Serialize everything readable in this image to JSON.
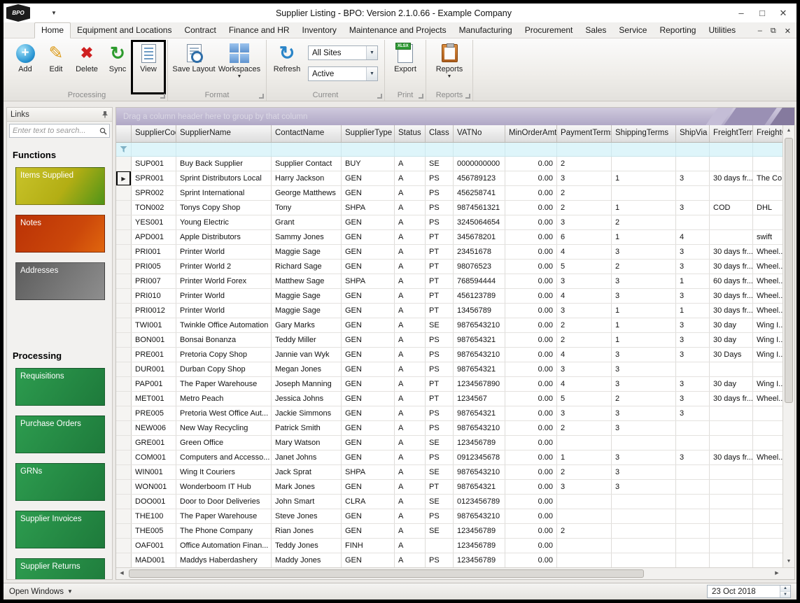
{
  "window": {
    "title": "Supplier Listing - BPO: Version 2.1.0.66 - Example Company",
    "logo_text": "BPO"
  },
  "ribbon": {
    "tabs": [
      "Home",
      "Equipment and Locations",
      "Contract",
      "Finance and HR",
      "Inventory",
      "Maintenance and Projects",
      "Manufacturing",
      "Procurement",
      "Sales",
      "Service",
      "Reporting",
      "Utilities"
    ],
    "active_tab": "Home",
    "buttons": {
      "add": "Add",
      "edit": "Edit",
      "delete": "Delete",
      "sync": "Sync",
      "view": "View",
      "save_layout": "Save Layout",
      "workspaces": "Workspaces",
      "refresh": "Refresh",
      "export": "Export",
      "reports": "Reports"
    },
    "export_badge": "XLSX",
    "dropdowns": {
      "sites": "All Sites",
      "status": "Active"
    },
    "groups": [
      "Processing",
      "Format",
      "Current",
      "Print",
      "Reports"
    ]
  },
  "sidebar": {
    "header": "Links",
    "search_placeholder": "Enter text to search...",
    "sections": [
      {
        "heading": "Functions",
        "items": [
          "Items Supplied",
          "Notes",
          "Addresses"
        ]
      },
      {
        "heading": "Processing",
        "items": [
          "Requisitions",
          "Purchase Orders",
          "GRNs",
          "Supplier Invoices",
          "Supplier Returns"
        ]
      }
    ]
  },
  "grid": {
    "group_hint": "Drag a column header here to group by that column",
    "columns": [
      "SupplierCode",
      "SupplierName",
      "ContactName",
      "SupplierType",
      "Status",
      "Class",
      "VATNo",
      "MinOrderAmt",
      "PaymentTerms",
      "ShippingTerms",
      "ShipVia",
      "FreightTerms",
      "FreightCa..."
    ],
    "focus_row": 1,
    "rows": [
      [
        "SUP001",
        "Buy Back Supplier",
        "Supplier Contact",
        "BUY",
        "A",
        "SE",
        "0000000000",
        "0.00",
        "2",
        "",
        "",
        "",
        ""
      ],
      [
        "SPR001",
        "Sprint Distributors Local",
        "Harry Jackson",
        "GEN",
        "A",
        "PS",
        "456789123",
        "0.00",
        "3",
        "1",
        "3",
        "30 days fr...",
        "The Co..."
      ],
      [
        "SPR002",
        "Sprint International",
        "George Matthews",
        "GEN",
        "A",
        "PS",
        "456258741",
        "0.00",
        "2",
        "",
        "",
        "",
        ""
      ],
      [
        "TON002",
        "Tonys Copy Shop",
        "Tony",
        "SHPA",
        "A",
        "PS",
        "9874561321",
        "0.00",
        "2",
        "1",
        "3",
        "COD",
        "DHL"
      ],
      [
        "YES001",
        "Young Electric",
        "Grant",
        "GEN",
        "A",
        "PS",
        "3245064654",
        "0.00",
        "3",
        "2",
        "",
        "",
        ""
      ],
      [
        "APD001",
        "Apple Distributors",
        "Sammy Jones",
        "GEN",
        "A",
        "PT",
        "345678201",
        "0.00",
        "6",
        "1",
        "4",
        "",
        "swift"
      ],
      [
        "PRI001",
        "Printer World",
        "Maggie Sage",
        "GEN",
        "A",
        "PT",
        "23451678",
        "0.00",
        "4",
        "3",
        "3",
        "30 days fr...",
        "Wheel..."
      ],
      [
        "PRI005",
        "Printer World 2",
        "Richard Sage",
        "GEN",
        "A",
        "PT",
        "98076523",
        "0.00",
        "5",
        "2",
        "3",
        "30 days fr...",
        "Wheel..."
      ],
      [
        "PRI007",
        "Printer World Forex",
        "Matthew Sage",
        "SHPA",
        "A",
        "PT",
        "768594444",
        "0.00",
        "3",
        "3",
        "1",
        "60 days fr...",
        "Wheel..."
      ],
      [
        "PRI010",
        "Printer World",
        "Maggie Sage",
        "GEN",
        "A",
        "PT",
        "456123789",
        "0.00",
        "4",
        "3",
        "3",
        "30 days fr...",
        "Wheel..."
      ],
      [
        "PRI0012",
        "Printer World",
        "Maggie Sage",
        "GEN",
        "A",
        "PT",
        "13456789",
        "0.00",
        "3",
        "1",
        "1",
        "30 days fr...",
        "Wheel..."
      ],
      [
        "TWI001",
        "Twinkle Office Automation",
        "Gary Marks",
        "GEN",
        "A",
        "SE",
        "9876543210",
        "0.00",
        "2",
        "1",
        "3",
        "30 day",
        "Wing I..."
      ],
      [
        "BON001",
        "Bonsai Bonanza",
        "Teddy Miller",
        "GEN",
        "A",
        "PS",
        "987654321",
        "0.00",
        "2",
        "1",
        "3",
        "30 day",
        "Wing I..."
      ],
      [
        "PRE001",
        "Pretoria Copy Shop",
        "Jannie van Wyk",
        "GEN",
        "A",
        "PS",
        "9876543210",
        "0.00",
        "4",
        "3",
        "3",
        "30 Days",
        "Wing I..."
      ],
      [
        "DUR001",
        "Durban Copy Shop",
        "Megan Jones",
        "GEN",
        "A",
        "PS",
        "987654321",
        "0.00",
        "3",
        "3",
        "",
        "",
        ""
      ],
      [
        "PAP001",
        "The Paper Warehouse",
        "Joseph Manning",
        "GEN",
        "A",
        "PT",
        "1234567890",
        "0.00",
        "4",
        "3",
        "3",
        "30 day",
        "Wing I..."
      ],
      [
        "MET001",
        "Metro Peach",
        "Jessica Johns",
        "GEN",
        "A",
        "PT",
        "1234567",
        "0.00",
        "5",
        "2",
        "3",
        "30 days fr...",
        "Wheel..."
      ],
      [
        "PRE005",
        "Pretoria West Office Aut...",
        "Jackie Simmons",
        "GEN",
        "A",
        "PS",
        "987654321",
        "0.00",
        "3",
        "3",
        "3",
        "",
        ""
      ],
      [
        "NEW006",
        "New Way Recycling",
        "Patrick Smith",
        "GEN",
        "A",
        "PS",
        "9876543210",
        "0.00",
        "2",
        "3",
        "",
        "",
        ""
      ],
      [
        "GRE001",
        "Green Office",
        "Mary Watson",
        "GEN",
        "A",
        "SE",
        "123456789",
        "0.00",
        "",
        "",
        "",
        "",
        ""
      ],
      [
        "COM001",
        "Computers and Accesso...",
        "Janet Johns",
        "GEN",
        "A",
        "PS",
        "0912345678",
        "0.00",
        "1",
        "3",
        "3",
        "30 days fr...",
        "Wheel..."
      ],
      [
        "WIN001",
        "Wing It Couriers",
        "Jack Sprat",
        "SHPA",
        "A",
        "SE",
        "9876543210",
        "0.00",
        "2",
        "3",
        "",
        "",
        ""
      ],
      [
        "WON001",
        "Wonderboom IT Hub",
        "Mark Jones",
        "GEN",
        "A",
        "PT",
        "987654321",
        "0.00",
        "3",
        "3",
        "",
        "",
        ""
      ],
      [
        "DOO001",
        "Door to Door Deliveries",
        "John Smart",
        "CLRA",
        "A",
        "SE",
        "0123456789",
        "0.00",
        "",
        "",
        "",
        "",
        ""
      ],
      [
        "THE100",
        "The Paper Warehouse",
        "Steve Jones",
        "GEN",
        "A",
        "PS",
        "9876543210",
        "0.00",
        "",
        "",
        "",
        "",
        ""
      ],
      [
        "THE005",
        "The Phone Company",
        "Rian Jones",
        "GEN",
        "A",
        "SE",
        "123456789",
        "0.00",
        "2",
        "",
        "",
        "",
        ""
      ],
      [
        "OAF001",
        "Office Automation Finan...",
        "Teddy Jones",
        "FINH",
        "A",
        "",
        "123456789",
        "0.00",
        "",
        "",
        "",
        "",
        ""
      ],
      [
        "MAD001",
        "Maddys Haberdashery",
        "Maddy Jones",
        "GEN",
        "A",
        "PS",
        "123456789",
        "0.00",
        "",
        "",
        "",
        "",
        ""
      ]
    ]
  },
  "statusbar": {
    "open_windows": "Open Windows",
    "date": "23 Oct 2018"
  },
  "colors": {
    "accent_blue": "#2a85c8",
    "filter_row": "#def5fa",
    "group_bar_purple": "#b0a8c6",
    "items_supplied_button": "#b3ae14",
    "notes_button": "#cc480a",
    "addresses_button": "#757575",
    "processing_button_green": "#2d9c4f",
    "export_badge_green": "#2f9a35"
  }
}
